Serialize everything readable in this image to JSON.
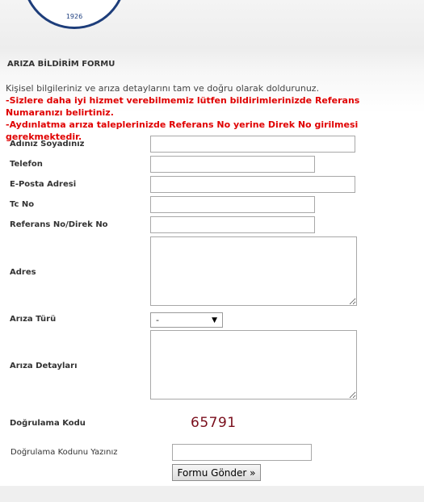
{
  "logo": {
    "year": "1926"
  },
  "form": {
    "title": "ARIZA BİLDİRİM FORMU",
    "intro": "Kişisel bilgileriniz ve arıza detaylarını tam ve doğru olarak doldurunuz.",
    "warning_1": "-Sizlere daha iyi hizmet verebilmemiz lütfen bildirimlerinizde Referans Numaranızı belirtiniz.",
    "warning_2": "-Aydınlatma arıza taleplerinizde Referans No yerine Direk No girilmesi gerekmektedir.",
    "fields": {
      "name_label": "Adınız Soyadınız",
      "name_value": "",
      "phone_label": "Telefon",
      "phone_value": "",
      "email_label": "E-Posta Adresi",
      "email_value": "",
      "tc_label": "Tc No",
      "tc_value": "",
      "ref_label": "Referans No/Direk No",
      "ref_value": "",
      "address_label": "Adres",
      "address_value": "",
      "fault_type_label": "Arıza Türü",
      "fault_type_selected": "-",
      "fault_details_label": "Arıza Detayları",
      "fault_details_value": ""
    },
    "captcha": {
      "label": "Doğrulama Kodu",
      "code": "65791",
      "input_label": "Doğrulama Kodunu Yazınız",
      "input_value": ""
    },
    "submit_label": "Formu Gönder »"
  }
}
